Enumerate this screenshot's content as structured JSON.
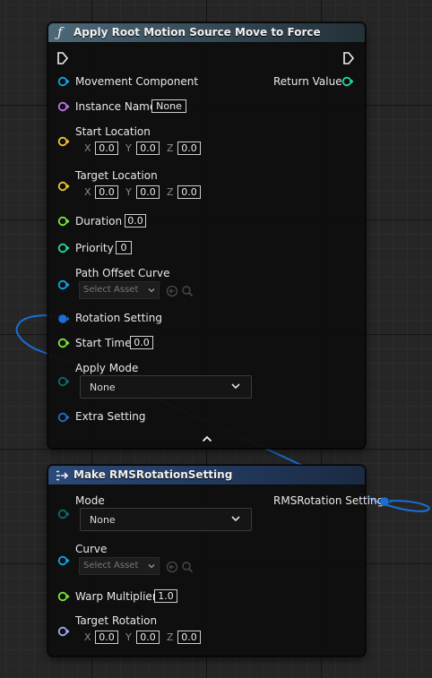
{
  "colors": {
    "function_header": "#4d6878",
    "make_header": "#2b4a78",
    "struct_pin": "#1b6ed6",
    "object_pin": "#0aa8e8",
    "name_pin": "#c66ef4",
    "vector_pin": "#f4c32b",
    "float_pin": "#7ce833",
    "int_pin": "#20d8a8",
    "byte_pin": "#0b6e6a",
    "rotator_pin": "#a2a8f8"
  },
  "apply_node": {
    "title": "Apply Root Motion Source Move to Force",
    "icon": "function-icon",
    "movement_component_label": "Movement Component",
    "return_value_label": "Return Value",
    "instance_name_label": "Instance Name",
    "instance_name_value": "None",
    "start_location_label": "Start Location",
    "start_location": {
      "x": "0.0",
      "y": "0.0",
      "z": "0.0"
    },
    "target_location_label": "Target Location",
    "target_location": {
      "x": "0.0",
      "y": "0.0",
      "z": "0.0"
    },
    "duration_label": "Duration",
    "duration_value": "0.0",
    "priority_label": "Priority",
    "priority_value": "0",
    "path_offset_curve_label": "Path Offset Curve",
    "path_offset_curve_value": "Select Asset",
    "rotation_setting_label": "Rotation Setting",
    "start_time_label": "Start Time",
    "start_time_value": "0.0",
    "apply_mode_label": "Apply Mode",
    "apply_mode_value": "None",
    "extra_setting_label": "Extra Setting"
  },
  "make_node": {
    "title": "Make RMSRotationSetting",
    "icon": "make-struct-icon",
    "mode_label": "Mode",
    "mode_value": "None",
    "output_label": "RMSRotation Setting",
    "curve_label": "Curve",
    "curve_value": "Select Asset",
    "warp_multiplier_label": "Warp Multiplier",
    "warp_multiplier_value": "1.0",
    "target_rotation_label": "Target Rotation",
    "target_rotation": {
      "x": "0.0",
      "y": "0.0",
      "z": "0.0"
    }
  },
  "axes": {
    "x": "X",
    "y": "Y",
    "z": "Z"
  }
}
